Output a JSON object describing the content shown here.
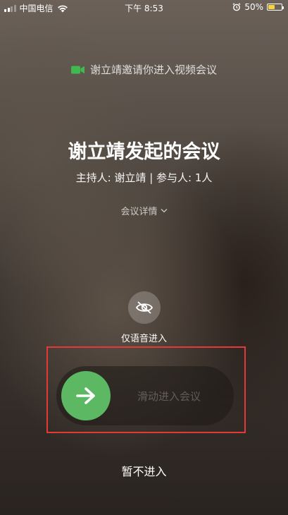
{
  "status_bar": {
    "carrier": "中国电信",
    "time": "下午 8:53",
    "battery_percent": "50%",
    "battery_level": 0.5,
    "battery_color": "#f7d33d"
  },
  "invite": {
    "text": "谢立靖邀请你进入视频会议",
    "icon": "video-camera-icon",
    "icon_color": "#3fb950"
  },
  "meeting": {
    "title": "谢立靖发起的会议",
    "info": "主持人: 谢立靖 | 参与人: 1人",
    "details_label": "会议详情"
  },
  "audio_only": {
    "label": "仅语音进入",
    "icon": "eye-off-icon"
  },
  "slider": {
    "label": "滑动进入会议",
    "knob_icon": "arrow-right-icon",
    "knob_color": "#5cb862"
  },
  "decline_label": "暂不进入",
  "highlight_color": "#e43a37"
}
